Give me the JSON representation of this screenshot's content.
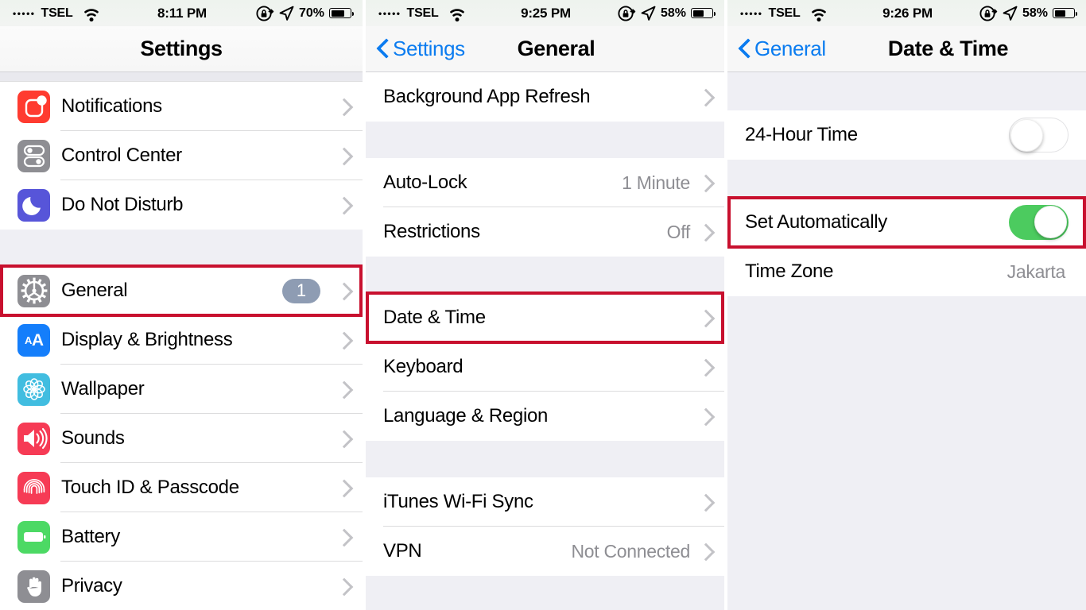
{
  "panels": [
    {
      "id": "settings",
      "status": {
        "dots": "•••••",
        "carrier": "TSEL",
        "wifi_icon": "wifi-icon",
        "time": "8:11 PM",
        "rotation_lock_icon": "rotation-lock-icon",
        "location_icon": "location-arrow-icon",
        "battery_percent": "70%",
        "battery_level": 70
      },
      "nav": {
        "title": "Settings",
        "back_label": null
      },
      "groups": [
        {
          "items": [
            {
              "label": "Notifications",
              "icon": "notifications-icon",
              "icon_color": "#ff3b30",
              "accessory": "chevron"
            },
            {
              "label": "Control Center",
              "icon": "control-center-icon",
              "icon_color": "#8e8e93",
              "accessory": "chevron"
            },
            {
              "label": "Do Not Disturb",
              "icon": "do-not-disturb-icon",
              "icon_color": "#5755d9",
              "accessory": "chevron"
            }
          ]
        },
        {
          "items": [
            {
              "label": "General",
              "icon": "gear-icon",
              "icon_color": "#8e8e93",
              "accessory": "chevron",
              "badge": "1",
              "highlighted": true
            },
            {
              "label": "Display & Brightness",
              "icon": "display-brightness-icon",
              "icon_color": "#147efb",
              "accessory": "chevron"
            },
            {
              "label": "Wallpaper",
              "icon": "wallpaper-icon",
              "icon_color": "#41bde0",
              "accessory": "chevron"
            },
            {
              "label": "Sounds",
              "icon": "sounds-icon",
              "icon_color": "#f63b55",
              "accessory": "chevron"
            },
            {
              "label": "Touch ID & Passcode",
              "icon": "touch-id-icon",
              "icon_color": "#f63b55",
              "accessory": "chevron"
            },
            {
              "label": "Battery",
              "icon": "battery-icon",
              "icon_color": "#4cd964",
              "accessory": "chevron"
            },
            {
              "label": "Privacy",
              "icon": "privacy-hand-icon",
              "icon_color": "#8e8e93",
              "accessory": "chevron"
            }
          ]
        }
      ]
    },
    {
      "id": "general",
      "status": {
        "dots": "•••••",
        "carrier": "TSEL",
        "wifi_icon": "wifi-icon",
        "time": "9:25 PM",
        "rotation_lock_icon": "rotation-lock-icon",
        "location_icon": "location-arrow-icon",
        "battery_percent": "58%",
        "battery_level": 58
      },
      "nav": {
        "title": "General",
        "back_label": "Settings"
      },
      "groups": [
        {
          "items": [
            {
              "label": "Background App Refresh",
              "accessory": "chevron"
            }
          ]
        },
        {
          "items": [
            {
              "label": "Auto-Lock",
              "value": "1 Minute",
              "accessory": "chevron"
            },
            {
              "label": "Restrictions",
              "value": "Off",
              "accessory": "chevron"
            }
          ]
        },
        {
          "items": [
            {
              "label": "Date & Time",
              "accessory": "chevron",
              "highlighted": true
            },
            {
              "label": "Keyboard",
              "accessory": "chevron"
            },
            {
              "label": "Language & Region",
              "accessory": "chevron"
            }
          ]
        },
        {
          "items": [
            {
              "label": "iTunes Wi-Fi Sync",
              "accessory": "chevron"
            },
            {
              "label": "VPN",
              "value": "Not Connected",
              "accessory": "chevron"
            }
          ]
        }
      ]
    },
    {
      "id": "date-time",
      "status": {
        "dots": "•••••",
        "carrier": "TSEL",
        "wifi_icon": "wifi-icon",
        "time": "9:26 PM",
        "rotation_lock_icon": "rotation-lock-icon",
        "location_icon": "location-arrow-icon",
        "battery_percent": "58%",
        "battery_level": 58
      },
      "nav": {
        "title": "Date & Time",
        "back_label": "General"
      },
      "groups": [
        {
          "items": [
            {
              "label": "24-Hour Time",
              "accessory": "toggle",
              "toggle_state": "off"
            }
          ]
        },
        {
          "items": [
            {
              "label": "Set Automatically",
              "accessory": "toggle",
              "toggle_state": "on",
              "highlighted": true
            },
            {
              "label": "Time Zone",
              "value": "Jakarta",
              "accessory": "none"
            }
          ]
        }
      ]
    }
  ],
  "colors": {
    "highlight": "#c8102e",
    "tint": "#0b7cf0",
    "toggle_on": "#4ccb5f",
    "badge": "#8e9cb3",
    "group_bg": "#efeff4"
  }
}
